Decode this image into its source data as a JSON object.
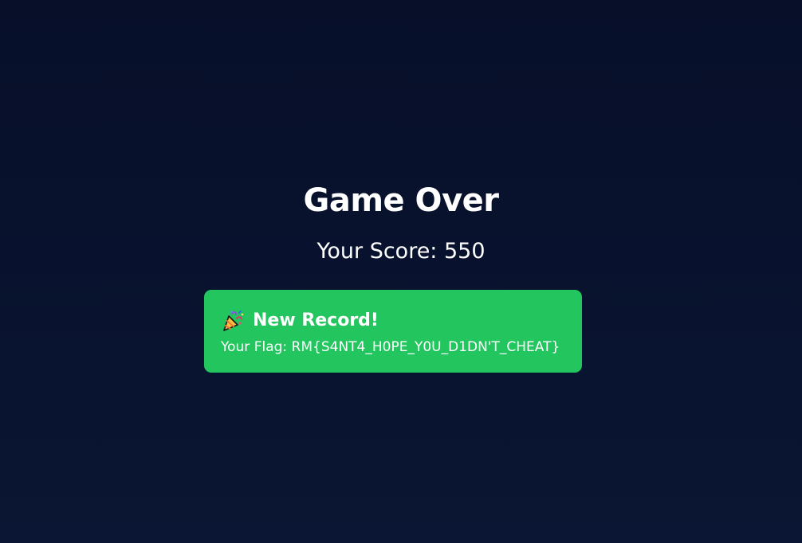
{
  "game_over": {
    "title": "Game Over",
    "score_text": "Your Score: 550"
  },
  "record": {
    "icon": "party-popper-icon",
    "title": "New Record!",
    "flag_text": "Your Flag: RM{S4NT4_H0PE_Y0U_D1DN'T_CHEAT}"
  },
  "colors": {
    "background": "#08132f",
    "card": "#22c55e",
    "text": "#ffffff"
  }
}
